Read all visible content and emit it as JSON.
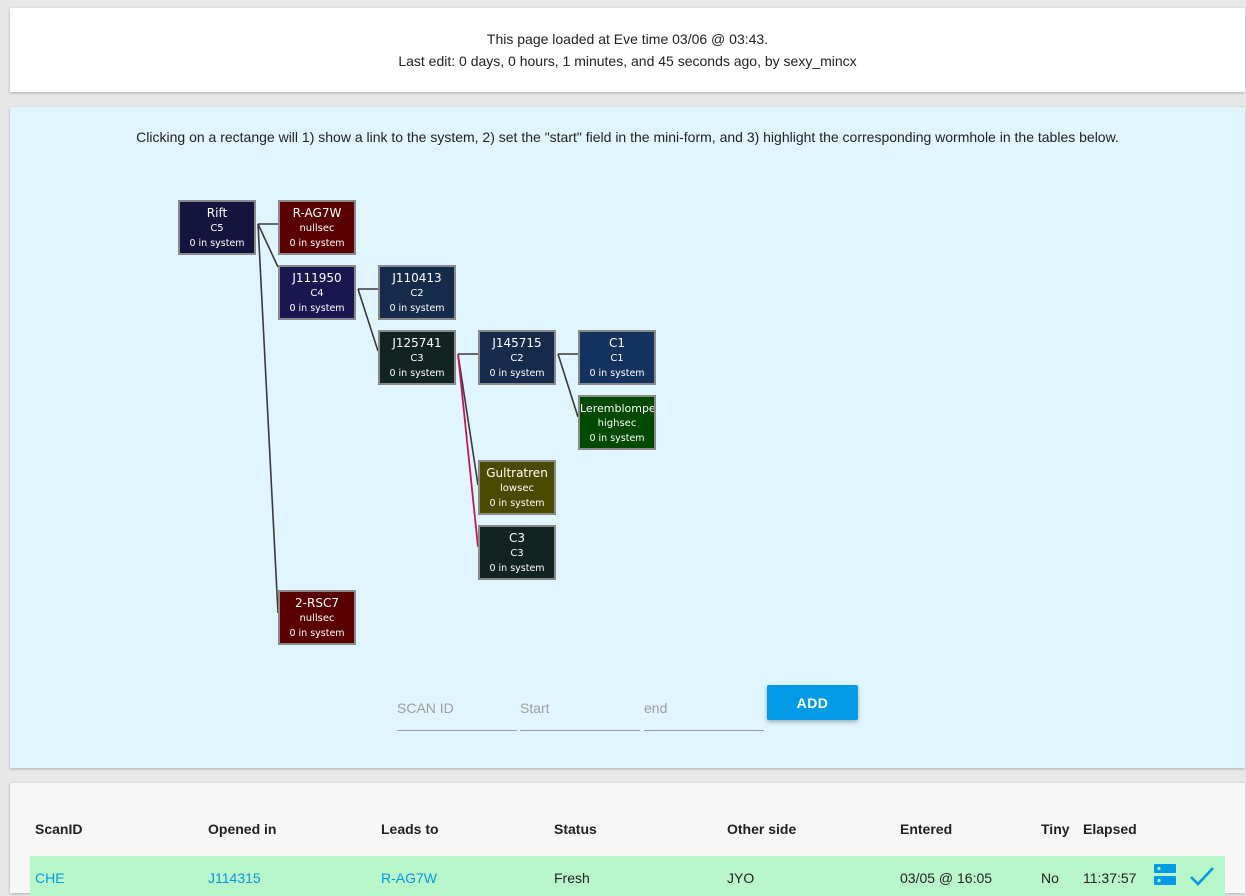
{
  "header": {
    "loaded_text": "This page loaded at Eve time 03/06 @ 03:43.",
    "last_edit_text": "Last edit: 0 days, 0 hours, 1 minutes, and 45 seconds ago, by sexy_mincx"
  },
  "map": {
    "instructions": "Clicking on a rectange will 1) show a link to the system, 2) set the \"start\" field in the mini-form, and 3) highlight the corresponding wormhole in the tables below.",
    "nodes": [
      {
        "id": "rift",
        "name": "Rift",
        "class": "C5",
        "count": "0 in system",
        "color": "#14143c"
      },
      {
        "id": "ragw",
        "name": "R-AG7W",
        "class": "nullsec",
        "count": "0 in system",
        "color": "#5a0000"
      },
      {
        "id": "j111950",
        "name": "J111950",
        "class": "C4",
        "count": "0 in system",
        "color": "#1a1650"
      },
      {
        "id": "j110413",
        "name": "J110413",
        "class": "C2",
        "count": "0 in system",
        "color": "#162a4c"
      },
      {
        "id": "j125741",
        "name": "J125741",
        "class": "C3",
        "count": "0 in system",
        "color": "#122422"
      },
      {
        "id": "j145715",
        "name": "J145715",
        "class": "C2",
        "count": "0 in system",
        "color": "#162a4c"
      },
      {
        "id": "c1",
        "name": "C1",
        "class": "C1",
        "count": "0 in system",
        "color": "#14325e"
      },
      {
        "id": "lerem",
        "name": "Leremblompes",
        "class": "highsec",
        "count": "0 in system",
        "color": "#004a00"
      },
      {
        "id": "gult",
        "name": "Gultratren",
        "class": "lowsec",
        "count": "0 in system",
        "color": "#4a4a00"
      },
      {
        "id": "c3",
        "name": "C3",
        "class": "C3",
        "count": "0 in system",
        "color": "#122422"
      },
      {
        "id": "rsc7",
        "name": "2-RSC7",
        "class": "nullsec",
        "count": "0 in system",
        "color": "#5a0000"
      }
    ],
    "connection_color": "#3a3a3a",
    "critical_connection_color": "#c2185b"
  },
  "form": {
    "scan_placeholder": "SCAN ID",
    "start_placeholder": "Start",
    "end_placeholder": "end",
    "add_label": "ADD",
    "add_color": "#039be5"
  },
  "table": {
    "headers": {
      "scanid": "ScanID",
      "opened": "Opened in",
      "leads": "Leads to",
      "status": "Status",
      "other": "Other side",
      "entered": "Entered",
      "tiny": "Tiny",
      "elapsed": "Elapsed"
    },
    "rows": [
      {
        "scanid": "CHE",
        "opened": "J114315",
        "leads": "R-AG7W",
        "status": "Fresh",
        "other": "JYO",
        "entered": "03/05 @ 16:05",
        "tiny": "No",
        "elapsed": "11:37:57",
        "edit_icon": "server-icon",
        "confirm_icon": "check-icon"
      }
    ],
    "row_color": "#b9f6ca",
    "link_color": "#039be5"
  }
}
